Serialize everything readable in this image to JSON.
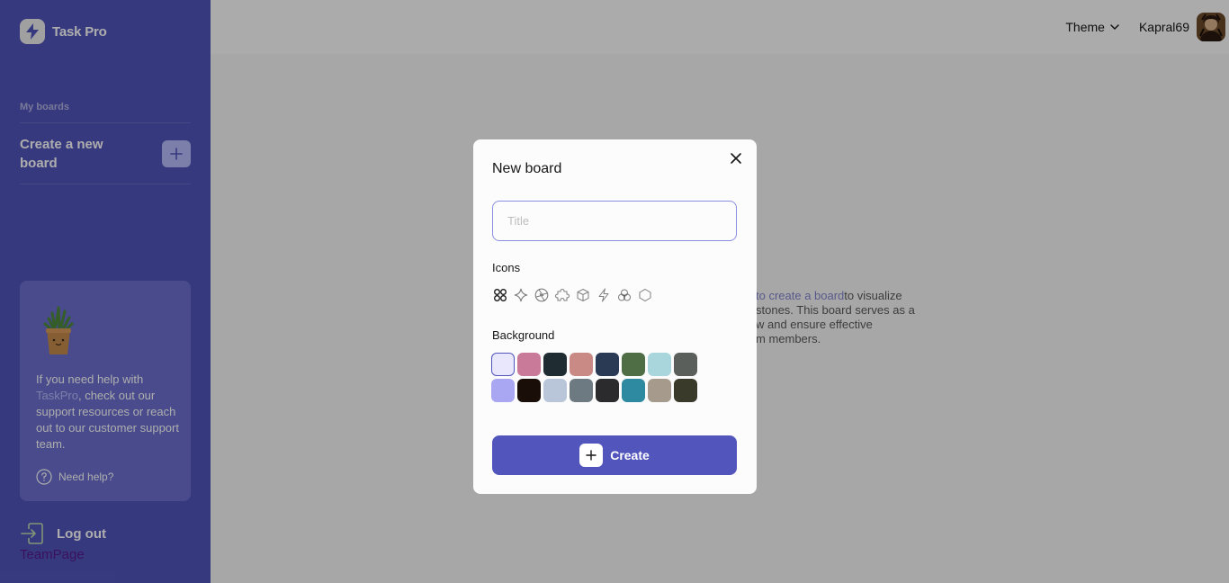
{
  "app": {
    "name": "Task Pro"
  },
  "sidebar": {
    "section_title": "My boards",
    "create_label": "Create a new board",
    "help": {
      "text_before": "If you need help with ",
      "link": "TaskPro",
      "text_after": ", check out our support resources or reach out to our customer support team.",
      "need_help": "Need help?"
    },
    "logout": "Log out",
    "team_link": "TeamPage"
  },
  "header": {
    "theme_label": "Theme",
    "username": "Kapral69"
  },
  "main": {
    "partial_link": "to create a board",
    "partial_lines": [
      "to visualize",
      "stones. This board serves as a",
      "w and ensure effective",
      "m members."
    ]
  },
  "modal": {
    "title": "New board",
    "title_placeholder": "Title",
    "title_value": "",
    "icons_label": "Icons",
    "icons": [
      "grid-icon",
      "sparkle-icon",
      "aperture-icon",
      "puzzle-icon",
      "cube-icon",
      "lightning-icon",
      "circles-icon",
      "hexagon-icon"
    ],
    "background_label": "Background",
    "backgrounds": [
      "#e8e7fb",
      "#c97a98",
      "#1f2d33",
      "#c98a86",
      "#2a3a55",
      "#4f6e45",
      "#a9d6dc",
      "#5b5f5c",
      "#a9a7f2",
      "#1a0e08",
      "#b9c6d9",
      "#6e7a82",
      "#2b2a2d",
      "#2e8aa0",
      "#a59a8c",
      "#3a3a2a"
    ],
    "create_label": "Create"
  },
  "colors": {
    "accent": "#5255bc",
    "sidebar_bg": "#5255bc"
  }
}
